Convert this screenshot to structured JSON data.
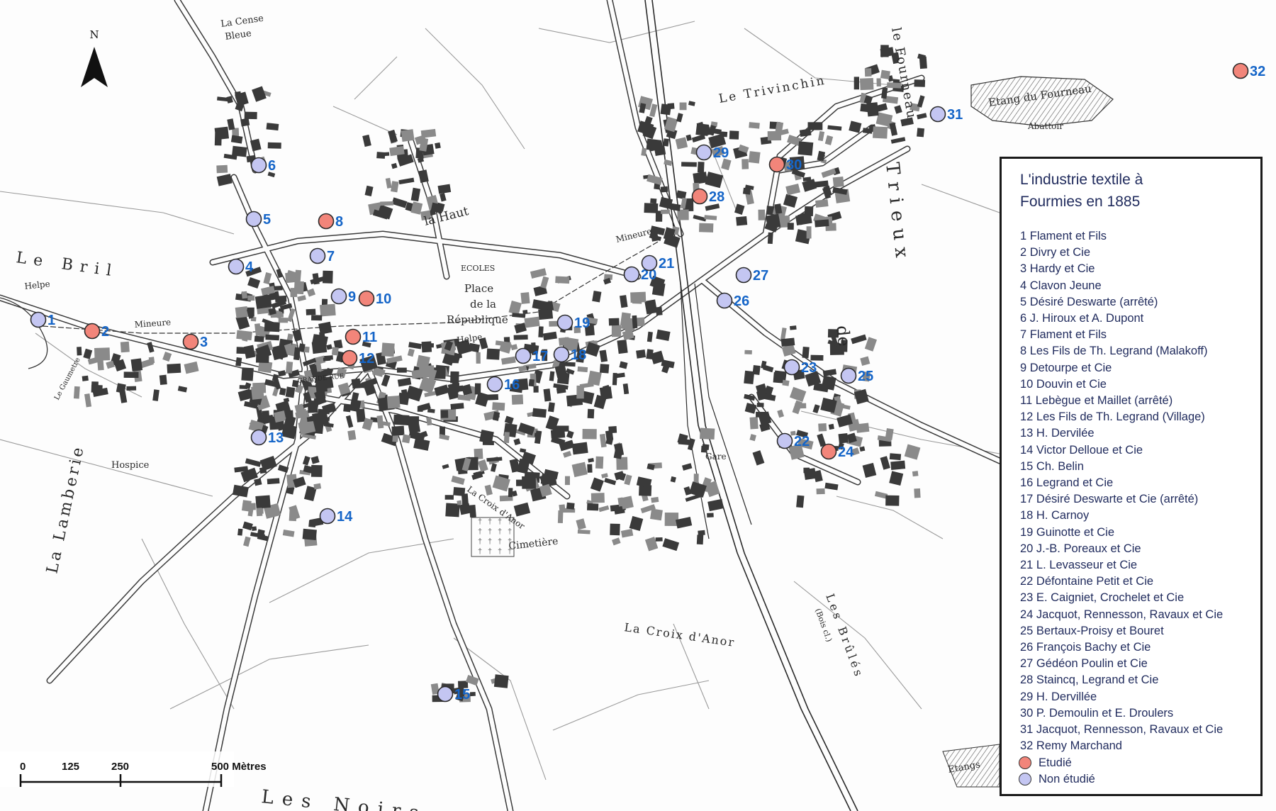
{
  "north_label": "N",
  "map_labels": {
    "la_cense_bleue_1": "La Cense",
    "la_cense_bleue_2": "Bleue",
    "le_bril": "Le Bril",
    "helpe_west": "Helpe",
    "mineure_west": "Mineure",
    "la_haut": "la Haut",
    "ecoles": "ECOLES",
    "place_1": "Place",
    "place_2": "de la",
    "place_3": "République",
    "helpe_center": "Helpe",
    "mineure_center": "Mineure",
    "le_trivinchin": "Le Trivinchin",
    "etang": "Etang du Fourneau",
    "abattoir": "Abattoir",
    "le_fourneau": "le Fourneau",
    "trieux": "Trieux",
    "de": "de",
    "la_lamberie": "La Lamberie",
    "hospice": "Hospice",
    "la_croix_anor_small": "La Croix d'Anor",
    "cimetiere": "Cimetière",
    "la_croix_anor": "La Croix d'Anor",
    "gare": "Gare",
    "les_brules": "Les Brûlés",
    "bois": "(Bois cl.)",
    "les_noirs": "Les Noirs",
    "etangs": "Etangs",
    "grande_rue": "GRANDE RUE",
    "le_gaumetre": "Le Gaumetre"
  },
  "scale_bar": {
    "ticks": [
      "0",
      "125",
      "250",
      "500 Mètres"
    ]
  },
  "legend": {
    "title_line1": "L'industrie textile à",
    "title_line2": "Fourmies en 1885",
    "items": [
      "1  Flament et Fils",
      "2 Divry et Cie",
      "3 Hardy et Cie",
      "4 Clavon Jeune",
      "5 Désiré Deswarte (arrêté)",
      "6 J. Hiroux et A. Dupont",
      "7 Flament et Fils",
      "8 Les Fils de Th. Legrand (Malakoff)",
      "9 Detourpe et Cie",
      "10  Douvin et Cie",
      "11 Lebègue et Maillet (arrêté)",
      "12  Les Fils de Th. Legrand (Village)",
      "13  H. Dervilée",
      "14  Victor Delloue et Cie",
      "15  Ch. Belin",
      "16  Legrand et Cie",
      "17  Désiré Deswarte et Cie (arrêté)",
      "18  H. Carnoy",
      "19  Guinotte et Cie",
      "20  J.-B. Poreaux et Cie",
      "21  L. Levasseur et Cie",
      "22  Défontaine Petit et Cie",
      "23  E. Caigniet, Crochelet et Cie",
      "24  Jacquot, Rennesson, Ravaux et Cie",
      "25  Bertaux-Proisy et Bouret",
      "26  François Bachy et Cie",
      "27  Gédéon Poulin et Cie",
      "28  Staincq, Legrand et Cie",
      "29  H. Dervillée",
      "30  P. Demoulin et E. Droulers",
      "31  Jacquot, Rennesson, Ravaux et Cie",
      "32  Remy Marchand"
    ],
    "key_studied": "Etudié",
    "key_not_studied": "Non étudié"
  },
  "colors": {
    "studied": "#f2857a",
    "not_studied": "#c4c6f2",
    "label": "#1565c8",
    "legend_text": "#1f2a5c"
  },
  "markers": [
    {
      "label": "1",
      "status": "not_studied"
    },
    {
      "label": "2",
      "status": "studied"
    },
    {
      "label": "3",
      "status": "studied"
    },
    {
      "label": "4",
      "status": "not_studied"
    },
    {
      "label": "5",
      "status": "not_studied"
    },
    {
      "label": "6",
      "status": "not_studied"
    },
    {
      "label": "7",
      "status": "not_studied"
    },
    {
      "label": "8",
      "status": "studied"
    },
    {
      "label": "9",
      "status": "not_studied"
    },
    {
      "label": "10",
      "status": "studied"
    },
    {
      "label": "11",
      "status": "studied"
    },
    {
      "label": "12",
      "status": "studied"
    },
    {
      "label": "13",
      "status": "not_studied"
    },
    {
      "label": "14",
      "status": "not_studied"
    },
    {
      "label": "15",
      "status": "not_studied"
    },
    {
      "label": "16",
      "status": "not_studied"
    },
    {
      "label": "17",
      "status": "not_studied"
    },
    {
      "label": "18",
      "status": "not_studied"
    },
    {
      "label": "19",
      "status": "not_studied"
    },
    {
      "label": "20",
      "status": "not_studied"
    },
    {
      "label": "21",
      "status": "not_studied"
    },
    {
      "label": "22",
      "status": "not_studied"
    },
    {
      "label": "23",
      "status": "not_studied"
    },
    {
      "label": "24",
      "status": "studied"
    },
    {
      "label": "25",
      "status": "not_studied"
    },
    {
      "label": "26",
      "status": "not_studied"
    },
    {
      "label": "27",
      "status": "not_studied"
    },
    {
      "label": "28",
      "status": "studied"
    },
    {
      "label": "29",
      "status": "not_studied"
    },
    {
      "label": "30",
      "status": "studied"
    },
    {
      "label": "31",
      "status": "not_studied"
    },
    {
      "label": "32",
      "status": "studied"
    }
  ]
}
